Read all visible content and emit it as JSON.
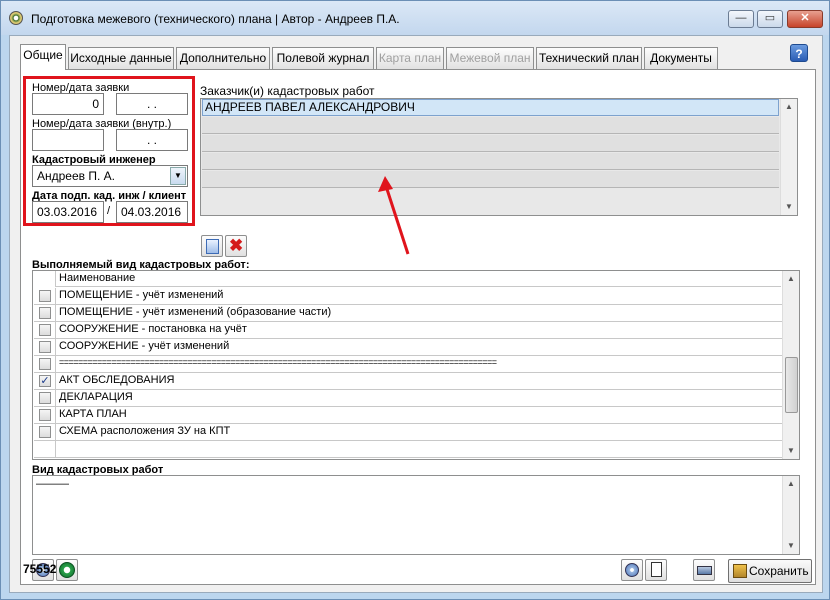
{
  "window": {
    "title": "Подготовка межевого (технического) плана | Автор - Андреев П.А.",
    "controls": {
      "minimize": "—",
      "maximize": "▭",
      "close": "✕"
    }
  },
  "tabs": [
    {
      "label": "Общие"
    },
    {
      "label": "Исходные данные"
    },
    {
      "label": "Дополнительно"
    },
    {
      "label": "Полевой журнал"
    },
    {
      "label": "Карта план"
    },
    {
      "label": "Межевой план"
    },
    {
      "label": "Технический план"
    },
    {
      "label": "Документы"
    }
  ],
  "help_label": "?",
  "request": {
    "number_date_label": "Номер/дата заявки",
    "number_value": "0",
    "date_value": ". .",
    "internal_label": "Номер/дата заявки (внутр.)",
    "internal_number": "",
    "internal_date": ". .",
    "engineer_label": "Кадастровый инженер",
    "engineer_value": "Андреев П. А.",
    "sign_dates_label": "Дата подп. кад. инж / клиент",
    "engineer_date": "03.03.2016",
    "separator": "/",
    "client_date": "04.03.2016"
  },
  "customers": {
    "label": "Заказчик(и) кадастровых работ",
    "rows": [
      "АНДРЕЕВ ПАВЕЛ АЛЕКСАНДРОВИЧ",
      "",
      "",
      "",
      ""
    ]
  },
  "works": {
    "label": "Выполняемый вид кадастровых работ:",
    "column_header": "Наименование",
    "rows": [
      {
        "text": "ПОМЕЩЕНИЕ - учёт изменений",
        "checked": false
      },
      {
        "text": "ПОМЕЩЕНИЕ - учёт изменений (образование части)",
        "checked": false
      },
      {
        "text": "СООРУЖЕНИЕ - постановка на учёт",
        "checked": false
      },
      {
        "text": "СООРУЖЕНИЕ - учёт изменений",
        "checked": false
      },
      {
        "text": "============================================================================================",
        "checked": false
      },
      {
        "text": "АКТ ОБСЛЕДОВАНИЯ",
        "checked": true
      },
      {
        "text": "ДЕКЛАРАЦИЯ",
        "checked": false
      },
      {
        "text": "КАРТА ПЛАН",
        "checked": false
      },
      {
        "text": "СХЕМА расположения ЗУ на КПТ",
        "checked": false
      },
      {
        "text": "",
        "checked": false
      }
    ]
  },
  "work_type": {
    "label": "Вид кадастровых работ",
    "value": "———"
  },
  "footer": {
    "record_id": "75552",
    "save_label": "Сохранить"
  },
  "colors": {
    "annotation": "#e0141c",
    "selection": "#d2e6f7"
  }
}
